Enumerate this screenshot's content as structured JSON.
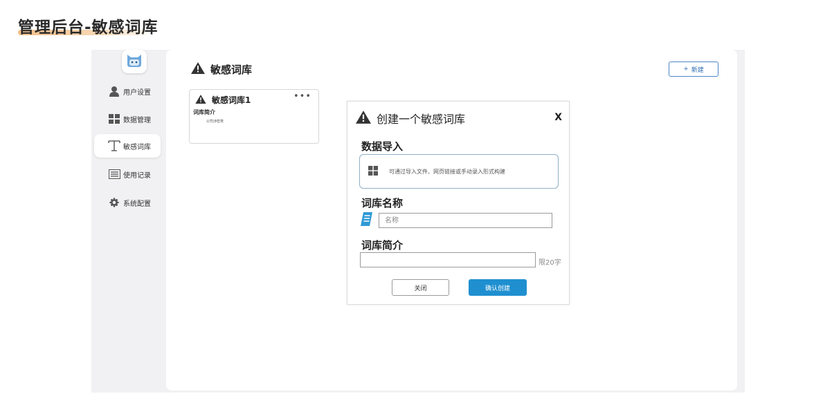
{
  "page": {
    "heading": "管理后台-敏感词库",
    "accent_color": "#f3c08a"
  },
  "sidebar": {
    "logo_icon": "cat-mascot-icon",
    "items": [
      {
        "label": "用户设置",
        "icon": "user-icon"
      },
      {
        "label": "数据管理",
        "icon": "grid-icon"
      },
      {
        "label": "敏感词库",
        "icon": "text-icon",
        "active": true
      },
      {
        "label": "使用记录",
        "icon": "list-icon"
      },
      {
        "label": "系统配置",
        "icon": "gear-icon"
      }
    ]
  },
  "main": {
    "title": "敏感词库",
    "title_icon": "warning-icon",
    "new_button": {
      "plus": "+",
      "label": "新建"
    },
    "cards": [
      {
        "title": "敏感词库1",
        "more": "•••",
        "desc_label": "词库简介",
        "desc": "公司涉密类"
      }
    ]
  },
  "modal": {
    "title": "创建一个敏感词库",
    "close": "X",
    "import_label": "数据导入",
    "import_hint": "可通过导入文件、网页链接或手动录入形式构建",
    "name_label": "词库名称",
    "name_placeholder": "名称",
    "desc_label": "词库简介",
    "desc_limit": "限20字",
    "cancel_label": "关闭",
    "confirm_label": "确认创建",
    "primary_color": "#1f8fd0",
    "book_icon_color": "#2f9ad6"
  }
}
